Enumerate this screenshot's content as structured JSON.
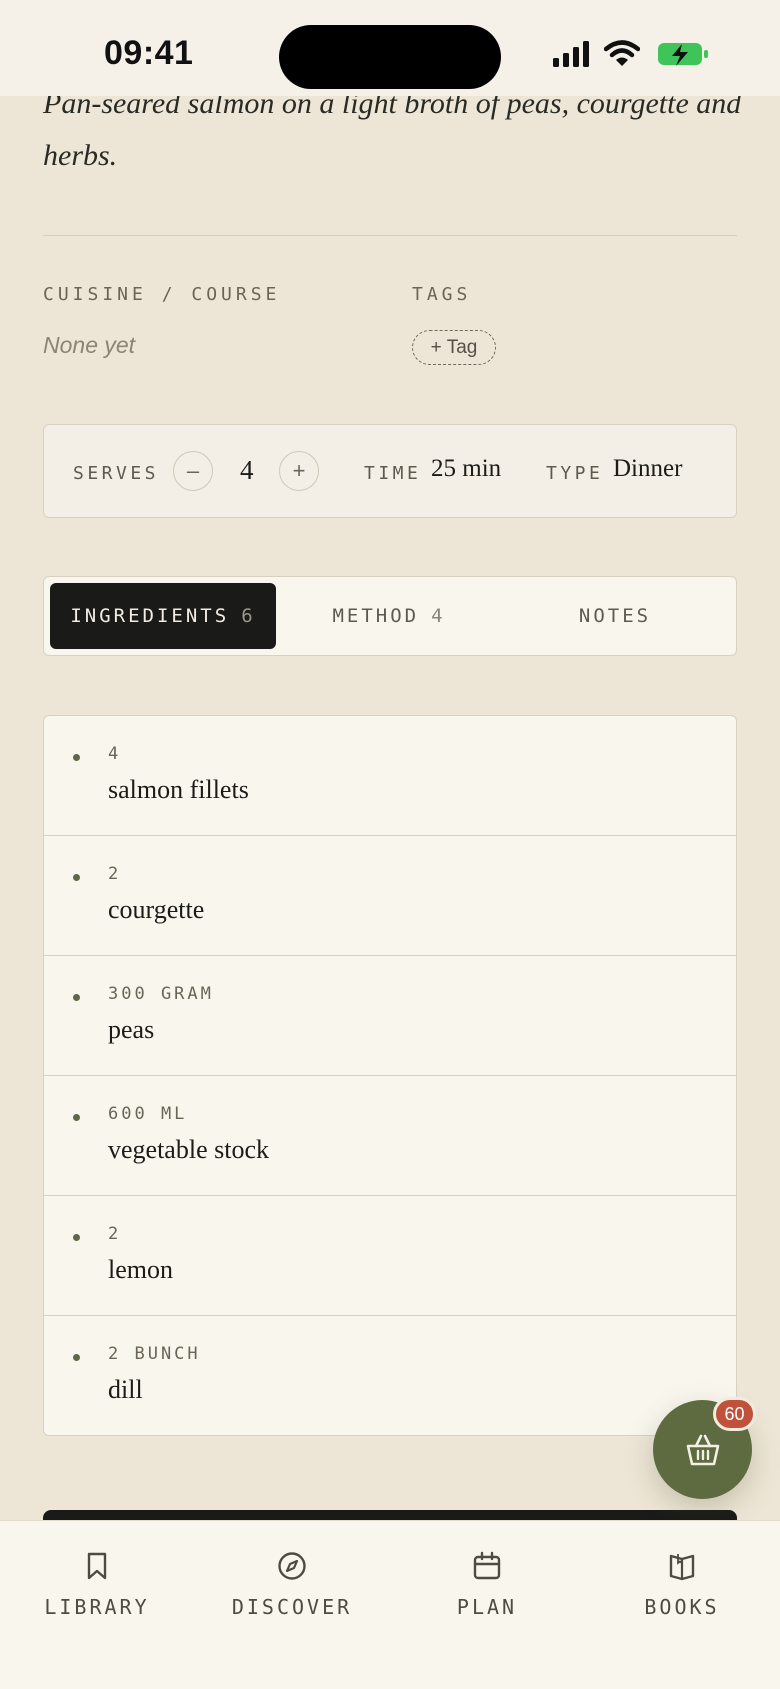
{
  "status_bar": {
    "time": "09:41"
  },
  "description": "Pan-seared salmon on a light broth of peas, courgette and herbs.",
  "meta": {
    "cuisine_label": "CUISINE / COURSE",
    "cuisine_value": "None yet",
    "tags_label": "TAGS",
    "add_tag_label": "+ Tag"
  },
  "info_bar": {
    "serves_label": "SERVES",
    "serves_value": "4",
    "minus_label": "–",
    "plus_label": "+",
    "time_label": "TIME",
    "time_value": "25 min",
    "type_label": "TYPE",
    "type_value": "Dinner"
  },
  "tabs": [
    {
      "label": "INGREDIENTS",
      "count": "6",
      "active": true
    },
    {
      "label": "METHOD",
      "count": "4",
      "active": false
    },
    {
      "label": "NOTES",
      "count": "",
      "active": false
    }
  ],
  "ingredients": [
    {
      "qty": "4",
      "name": "salmon fillets"
    },
    {
      "qty": "2",
      "name": "courgette"
    },
    {
      "qty": "300 GRAM",
      "name": "peas"
    },
    {
      "qty": "600 ML",
      "name": "vegetable stock"
    },
    {
      "qty": "2",
      "name": "lemon"
    },
    {
      "qty": "2 BUNCH",
      "name": "dill"
    }
  ],
  "basket": {
    "icon": "basket-icon",
    "badge": "60"
  },
  "bottom_nav": [
    {
      "label": "LIBRARY",
      "icon": "bookmark-icon"
    },
    {
      "label": "DISCOVER",
      "icon": "compass-icon"
    },
    {
      "label": "PLAN",
      "icon": "calendar-icon"
    },
    {
      "label": "BOOKS",
      "icon": "open-book-icon"
    }
  ],
  "colors": {
    "background": "#ede6d6",
    "accent_green": "#5e6a40",
    "badge_red": "#c0513a",
    "active_tab": "#1a1a18"
  }
}
